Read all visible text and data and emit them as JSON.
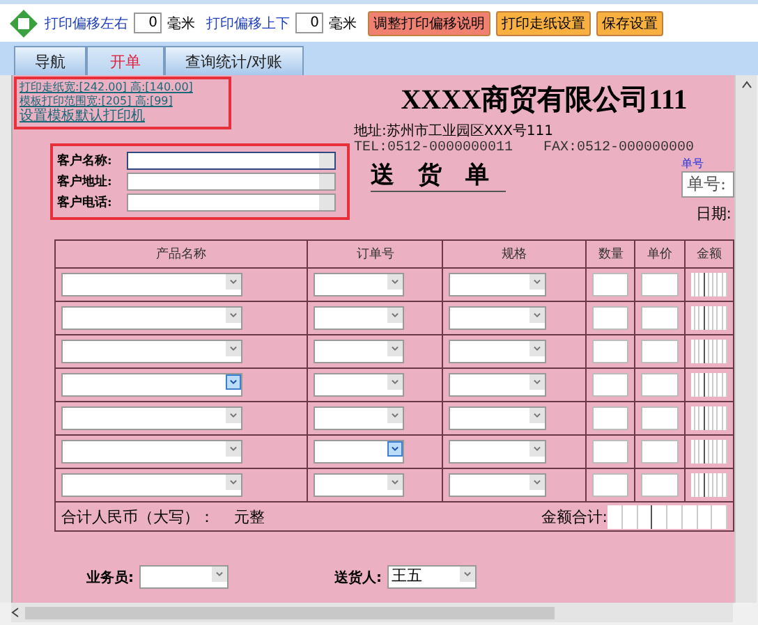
{
  "toolbar": {
    "offset_x_label": "打印偏移左右",
    "offset_x_value": "0",
    "offset_x_unit": "毫米",
    "offset_y_label": "打印偏移上下",
    "offset_y_value": "0",
    "offset_y_unit": "毫米",
    "buttons": [
      {
        "label": "调整打印偏移说明",
        "color": "#f08070"
      },
      {
        "label": "打印走纸设置",
        "color": "#f8b040"
      },
      {
        "label": "保存设置",
        "color": "#f8b040"
      }
    ]
  },
  "tabs": [
    {
      "label": "导航",
      "selected": false
    },
    {
      "label": "开单",
      "selected": true
    },
    {
      "label": "查询统计/对账",
      "selected": false
    }
  ],
  "form": {
    "links": [
      "打印走纸宽:[242.00] 高:[140.00]",
      "模板打印范围宽:[205] 高:[99]",
      "设置模板默认打印机"
    ],
    "company": "XXXX商贸有限公司111",
    "address": "地址:苏州市工业园区XXX号111",
    "tel": "TEL:0512-0000000011",
    "fax": "FAX:0512-000000000",
    "doc_title": "送　货　单",
    "order_no_caption": "单号",
    "order_no_label": "单号:",
    "date_label": "日期:",
    "customer_fields": [
      {
        "label": "客户名称:",
        "focused": true
      },
      {
        "label": "客户地址:",
        "focused": false
      },
      {
        "label": "客户电话:",
        "focused": false
      }
    ],
    "table": {
      "columns": [
        "产品名称",
        "订单号",
        "规格",
        "数量",
        "单价",
        "金额"
      ],
      "rows": [
        {
          "product_hot": false,
          "order_hot": false
        },
        {
          "product_hot": false,
          "order_hot": false
        },
        {
          "product_hot": false,
          "order_hot": false
        },
        {
          "product_hot": true,
          "order_hot": false
        },
        {
          "product_hot": false,
          "order_hot": false
        },
        {
          "product_hot": false,
          "order_hot": true
        },
        {
          "product_hot": false,
          "order_hot": false
        }
      ]
    },
    "total_label": "合计人民币（大写）：",
    "total_words": "元整",
    "amount_total_label": "金额合计:",
    "staff_label": "业务员:",
    "deliverer_label": "送货人:",
    "deliverer_value": "王五"
  }
}
